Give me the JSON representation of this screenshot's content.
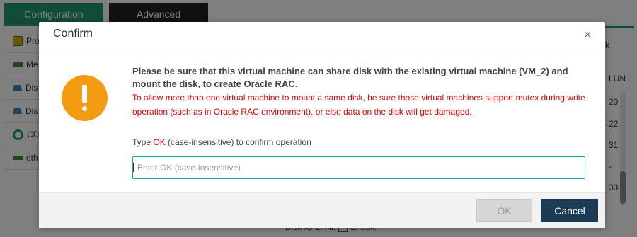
{
  "app": {
    "tabs": [
      {
        "label": "Configuration"
      },
      {
        "label": "Advanced"
      }
    ],
    "left_items": [
      {
        "label": "Pro",
        "icon": "cpu-icon"
      },
      {
        "label": "Me",
        "icon": "memory-icon"
      },
      {
        "label": "Dis",
        "icon": "disk-icon"
      },
      {
        "label": "Dis",
        "icon": "disk-icon"
      },
      {
        "label": "CD",
        "icon": "cd-icon"
      },
      {
        "label": "eth",
        "icon": "network-icon"
      }
    ],
    "right_fragment": "k",
    "lun_header": "LUN",
    "lun_values": [
      "20",
      "22",
      "31",
      "-",
      "33"
    ],
    "disk_io_label": "Disk IO Limit:",
    "enable_label": "Enable"
  },
  "dialog": {
    "title": "Confirm",
    "close_symbol": "×",
    "main_message": "Please be sure that this virtual machine can share disk with the existing virtual machine (VM_2) and mount the disk, to create Oracle RAC.",
    "warning_message": "To allow more than one virtual machine to mount a same disk, be sure those virtual machines support mutex during write operation (such as in Oracle RAC environment), or else data on the disk will get damaged.",
    "prompt_prefix": "Type ",
    "prompt_ok": "OK",
    "prompt_suffix": " (case-insensitive) to confirm operation",
    "input_value": "",
    "input_placeholder": "Enter OK (case-insensitive)",
    "ok_label": "OK",
    "cancel_label": "Cancel",
    "colors": {
      "warning_icon": "#f39c12",
      "warning_text": "#e00000",
      "cancel_button": "#1c3b56",
      "input_border": "#1aa8a0"
    }
  }
}
